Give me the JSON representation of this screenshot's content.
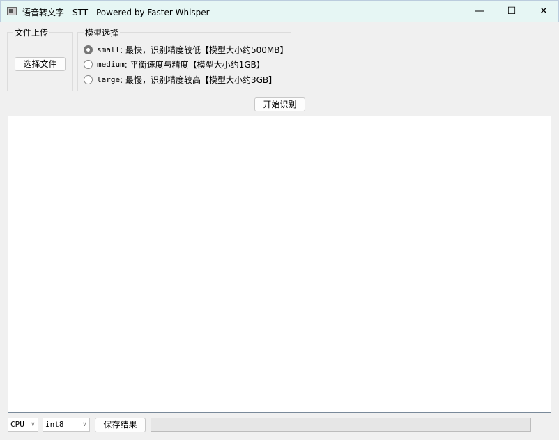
{
  "window": {
    "title": "语音转文字 - STT - Powered by Faster Whisper",
    "minimize": "—",
    "maximize": "☐",
    "close": "✕"
  },
  "upload": {
    "group_label": "文件上传",
    "select_button": "选择文件"
  },
  "model": {
    "group_label": "模型选择",
    "options": [
      {
        "name": "small",
        "desc": ": 最快，识别精度较低【模型大小约500MB】",
        "selected": true
      },
      {
        "name": "medium",
        "desc": ": 平衡速度与精度【模型大小约1GB】",
        "selected": false
      },
      {
        "name": "large",
        "desc": ": 最慢，识别精度较高【模型大小约3GB】",
        "selected": false
      }
    ]
  },
  "start_button": "开始识别",
  "result_text": "",
  "bottom": {
    "device": "CPU",
    "compute_type": "int8",
    "save_button": "保存结果",
    "progress_percent": 0
  }
}
